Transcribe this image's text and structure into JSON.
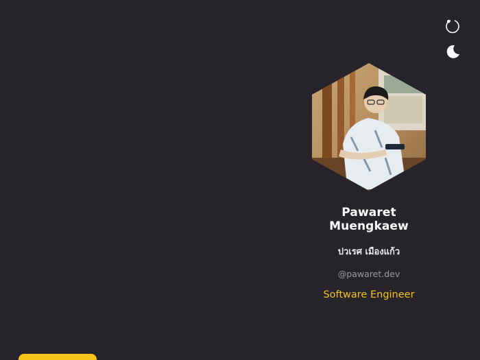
{
  "controls": {
    "reload_icon": "reload-icon",
    "theme_icon": "moon-icon"
  },
  "profile": {
    "name": "Pawaret Muengkaew",
    "thai_name": "ปวเรศ เมืองแก้ว",
    "handle": "@pawaret.dev",
    "role": "Software Engineer"
  },
  "colors": {
    "background": "#27242b",
    "accent": "#f5c518",
    "name_text": "#ffffff",
    "muted_text": "#9d99a3"
  }
}
